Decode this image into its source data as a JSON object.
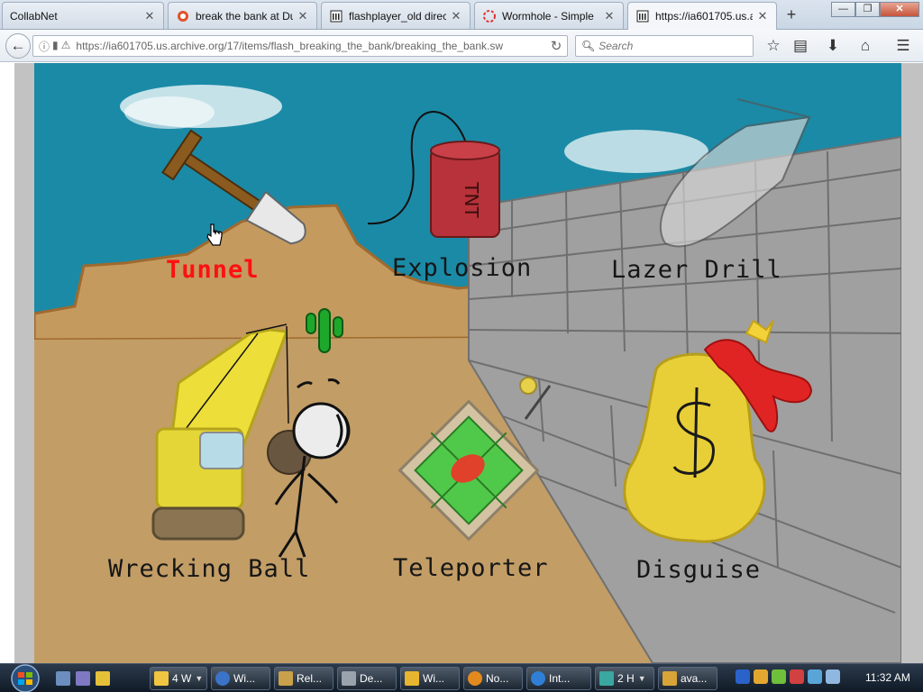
{
  "browser": {
    "tabs": [
      {
        "title": "CollabNet",
        "active": false
      },
      {
        "title": "break the bank at Du",
        "active": false
      },
      {
        "title": "flashplayer_old direc",
        "active": false
      },
      {
        "title": "Wormhole - Simple",
        "active": false
      },
      {
        "title": "https://ia601705.us.a",
        "active": true
      }
    ],
    "url": "https://ia601705.us.archive.org/17/items/flash_breaking_the_bank/breaking_the_bank.sw",
    "search_placeholder": "Search"
  },
  "game": {
    "options": {
      "tunnel": "Tunnel",
      "explosion": "Explosion",
      "lazer_drill": "Lazer Drill",
      "wrecking_ball": "Wrecking Ball",
      "teleporter": "Teleporter",
      "disguise": "Disguise"
    },
    "highlighted_option": "Tunnel",
    "dynamite_text": "TNT"
  },
  "taskbar": {
    "buttons": [
      {
        "label": "4 W",
        "has_arrow": true
      },
      {
        "label": "Wi...",
        "has_arrow": false
      },
      {
        "label": "Rel...",
        "has_arrow": false
      },
      {
        "label": "De...",
        "has_arrow": false
      },
      {
        "label": "Wi...",
        "has_arrow": false
      },
      {
        "label": "No...",
        "has_arrow": false
      },
      {
        "label": "Int...",
        "has_arrow": false
      },
      {
        "label": "2 H",
        "has_arrow": true
      },
      {
        "label": "ava...",
        "has_arrow": false
      }
    ],
    "clock": "11:32 AM"
  },
  "colors": {
    "sky": "#1b8aa6",
    "ground": "#c29a63",
    "wall": "#9e9e9e",
    "highlight_label": "#ff1010"
  }
}
